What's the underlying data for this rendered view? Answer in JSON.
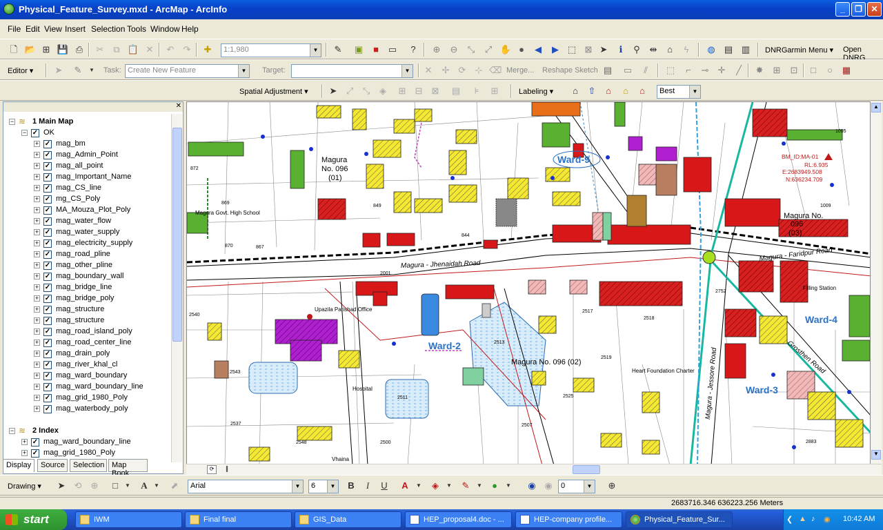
{
  "window": {
    "title": "Physical_Feature_Survey.mxd - ArcMap - ArcInfo"
  },
  "menu": [
    "File",
    "Edit",
    "View",
    "Insert",
    "Selection",
    "Tools",
    "Window",
    "Help"
  ],
  "toolbar1": {
    "scale": "1:1,980",
    "garmin": "DNRGarmin Menu",
    "open": "Open DNRG"
  },
  "editor": {
    "label": "Editor",
    "task_label": "Task:",
    "task_value": "Create New Feature",
    "target_label": "Target:",
    "merge": "Merge...",
    "reshape": "Reshape Sketch"
  },
  "spatial": {
    "label": "Spatial Adjustment",
    "labeling": "Labeling",
    "best": "Best"
  },
  "toc": {
    "group1": "1 Main Map",
    "ok": "OK",
    "layers": [
      "mag_bm",
      "mag_Admin_Point",
      "mag_all_point",
      "mag_Important_Name",
      "mag_CS_line",
      "mg_CS_Poly",
      "MA_Mouza_Plot_Poly",
      "mag_water_flow",
      "mag_water_supply",
      "mag_electricity_supply",
      "mag_road_pline",
      "mag_other_pline",
      "mag_boundary_wall",
      "mag_bridge_line",
      "mag_bridge_poly",
      "mag_structure",
      "mag_structure",
      "mag_road_island_poly",
      "mag_road_center_line",
      "mag_drain_poly",
      "mag_river_khal_cl",
      "mag_ward_boundary",
      "mag_ward_boundary_line",
      "mag_grid_1980_Poly",
      "mag_waterbody_poly"
    ],
    "group2": "2 Index",
    "index_layers": [
      "mag_ward_boundary_line",
      "mag_grid_1980_Poly"
    ],
    "tabs": [
      "Display",
      "Source",
      "Selection",
      "Map Book"
    ]
  },
  "map": {
    "labels": {
      "ward9": "Ward-9",
      "ward2": "Ward-2",
      "ward4": "Ward-4",
      "ward3": "Ward-3",
      "jhenaidah": "Magura - Jhenaidah Road",
      "faridpur": "Magura - Faridpur Road",
      "jessore": "Magura - Jessore Road",
      "mouza1": "Magura",
      "mouza1b": "No. 096",
      "mouza1c": "(01)",
      "mouza2": "Magura No. 096 (02)",
      "mouza3": "Magura No.",
      "mouza3b": "096",
      "mouza3c": "(03)",
      "bm1": "BM_ID:MA-01",
      "bm2": "RL:6.935",
      "bm3": "E:2683949.508",
      "bm4": "N:636234.709",
      "govtschool": "Magura Govt. High School",
      "upazila": "Upazila Parishad Office",
      "vhaina": "Vhaina",
      "heart": "Heart Foundation Charter",
      "garden": "Grosthen Road",
      "hospital": "Hospital",
      "filling": "Filling Station",
      "plot2001": "2001",
      "plot2513": "2513",
      "plot2519": "2519",
      "plot2525": "2525",
      "plot2507": "2507",
      "plot2511": "2511",
      "plot849": "849",
      "plot844": "844",
      "plot867": "867",
      "plot870": "870",
      "plot869": "869",
      "plot872": "872",
      "plot2517": "2517",
      "plot2518": "2518",
      "plot2540": "2540",
      "plot2543": "2543",
      "plot2537": "2537",
      "plot2548": "2548",
      "plot2500": "2500",
      "plot2883": "2883",
      "plot2752": "2752",
      "plot1009": "1009",
      "plot1005": "1005"
    }
  },
  "drawing": {
    "label": "Drawing",
    "font": "Arial",
    "size": "6",
    "value": "0"
  },
  "status": {
    "coords": "2683716.346  636223.256 Meters"
  },
  "taskbar": {
    "start": "start",
    "items": [
      "IWM",
      "Final final",
      "GIS_Data",
      "HEP_proposal4.doc - ...",
      "HEP-company profile...",
      "Physical_Feature_Sur..."
    ],
    "clock": "10:42 AM"
  }
}
